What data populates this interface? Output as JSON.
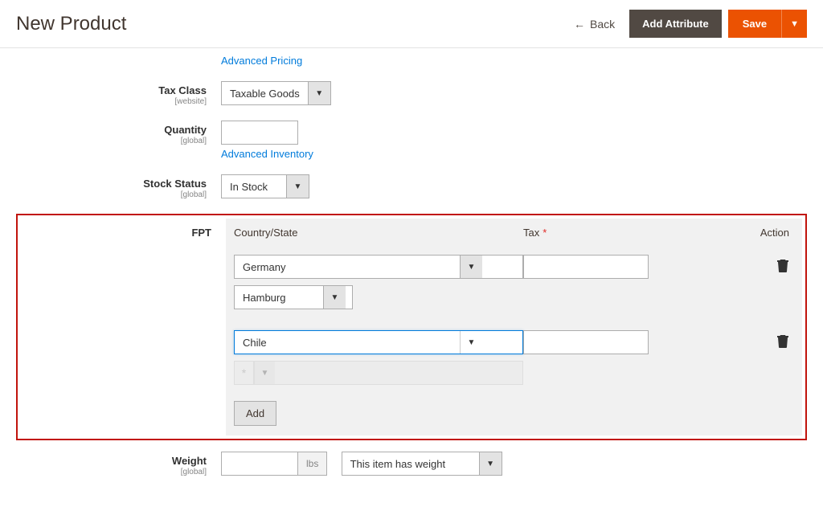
{
  "header": {
    "title": "New Product",
    "back_label": "Back",
    "add_attribute_label": "Add Attribute",
    "save_label": "Save"
  },
  "form": {
    "advanced_pricing_link": "Advanced Pricing",
    "tax_class": {
      "label": "Tax Class",
      "scope": "[website]",
      "value": "Taxable Goods"
    },
    "quantity": {
      "label": "Quantity",
      "scope": "[global]",
      "value": "",
      "advanced_inventory_link": "Advanced Inventory"
    },
    "stock_status": {
      "label": "Stock Status",
      "scope": "[global]",
      "value": "In Stock"
    },
    "fpt": {
      "label": "FPT",
      "columns": {
        "country_state": "Country/State",
        "tax": "Tax",
        "action": "Action"
      },
      "rows": [
        {
          "country": "Germany",
          "state": "Hamburg",
          "state_enabled": true,
          "tax_value": ""
        },
        {
          "country": "Chile",
          "state": "*",
          "state_enabled": false,
          "tax_value": ""
        }
      ],
      "add_label": "Add"
    },
    "weight": {
      "label": "Weight",
      "scope": "[global]",
      "value": "",
      "unit": "lbs",
      "has_weight_value": "This item has weight"
    }
  }
}
